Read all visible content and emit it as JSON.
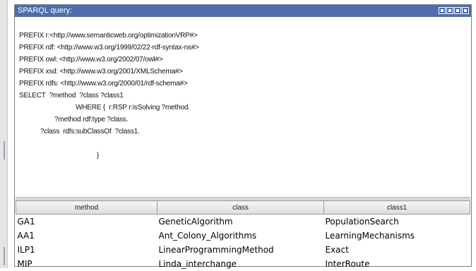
{
  "window": {
    "title": "SPARQL query:"
  },
  "query": {
    "lines": [
      "PREFIX r:<http://www.semanticweb.org/optimizationVRP#>",
      "PREFIX rdf: <http://www.w3.org/1999/02/22-rdf-syntax-ns#>",
      "PREFIX owl: <http://www.w3.org/2002/07/owl#>",
      "PREFIX xsd: <http://www.w3.org/2001/XMLSchema#>",
      "PREFIX rdfs: <http://www.w3.org/2000/01/rdf-schema#>",
      "SELECT  ?method  ?class ?class1",
      "WHERE {  r:RSP r:isSolving ?method.",
      "?method rdf:type ?class.",
      "?class  rdfs:subClassOf  ?class1.",
      "}"
    ]
  },
  "results": {
    "columns": [
      "method",
      "class",
      "class1"
    ],
    "rows": [
      [
        "GA1",
        "GeneticAlgorithm",
        "PopulationSearch"
      ],
      [
        "AA1",
        "Ant_Colony_Algorithms",
        "LearningMechanisms"
      ],
      [
        "ILP1",
        "LinearProgrammingMethod",
        "Exact"
      ],
      [
        "MIP",
        "Linda_interchange",
        "InterRoute"
      ]
    ]
  }
}
